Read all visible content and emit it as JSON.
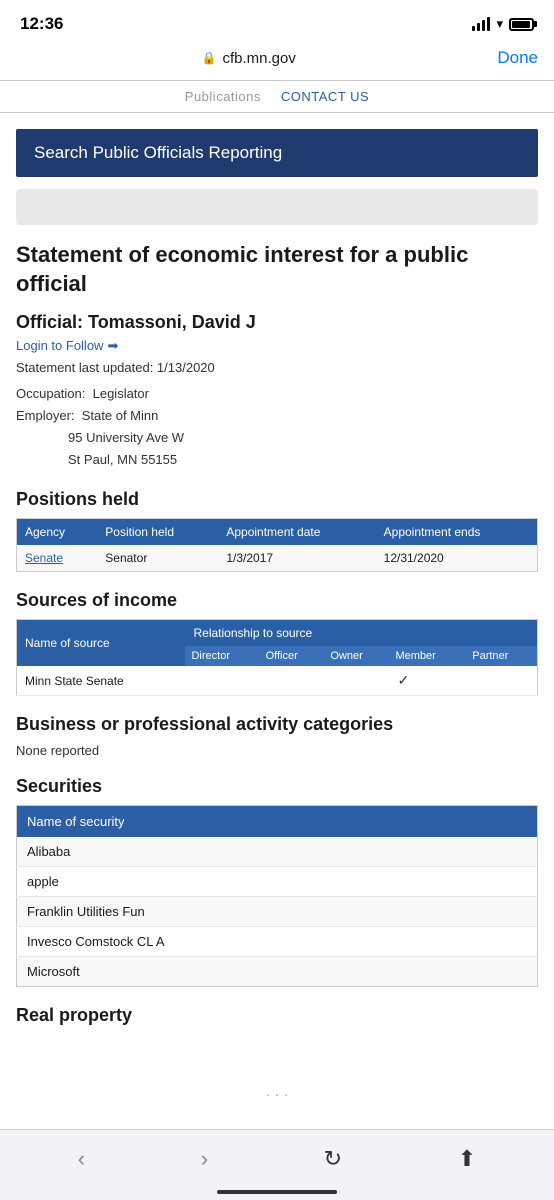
{
  "statusBar": {
    "time": "12:36"
  },
  "browserBar": {
    "url": "cfb.mn.gov",
    "doneLabel": "Done"
  },
  "navBar": {
    "publications": "Publications",
    "contactUs": "CONTACT US"
  },
  "searchBanner": {
    "text": "Search Public Officials Reporting"
  },
  "pageTitle": "Statement of economic interest for a public official",
  "official": {
    "nameLabel": "Official:",
    "name": "Tomassoni, David J",
    "loginLink": "Login to Follow",
    "statementDate": "Statement last updated: 1/13/2020",
    "occupationLabel": "Occupation:",
    "occupation": "Legislator",
    "employerLabel": "Employer:",
    "employer": "State of Minn",
    "address1": "95 University Ave W",
    "address2": "St Paul, MN 55155"
  },
  "positionsHeld": {
    "sectionTitle": "Positions held",
    "headers": [
      "Agency",
      "Position held",
      "Appointment date",
      "Appointment ends"
    ],
    "rows": [
      {
        "agency": "Senate",
        "position": "Senator",
        "appointmentDate": "1/3/2017",
        "appointmentEnds": "12/31/2020"
      }
    ]
  },
  "sourcesOfIncome": {
    "sectionTitle": "Sources of income",
    "mainHeaders": [
      "Name of source",
      "Relationship to source"
    ],
    "subHeaders": [
      "Director",
      "Officer",
      "Owner",
      "Member",
      "Partner"
    ],
    "rows": [
      {
        "name": "Minn State Senate",
        "director": "",
        "officer": "",
        "owner": "",
        "member": "✓",
        "partner": ""
      }
    ]
  },
  "businessCategories": {
    "sectionTitle": "Business or professional activity categories",
    "noneReported": "None reported"
  },
  "securities": {
    "sectionTitle": "Securities",
    "header": "Name of security",
    "items": [
      "Alibaba",
      "apple",
      "Franklin Utilities Fun",
      "Invesco Comstock CL A",
      "Microsoft"
    ]
  },
  "realProperty": {
    "sectionTitle": "Real property"
  },
  "bottomNav": {
    "back": "‹",
    "forward": "›",
    "refresh": "↻",
    "share": "⬆"
  }
}
